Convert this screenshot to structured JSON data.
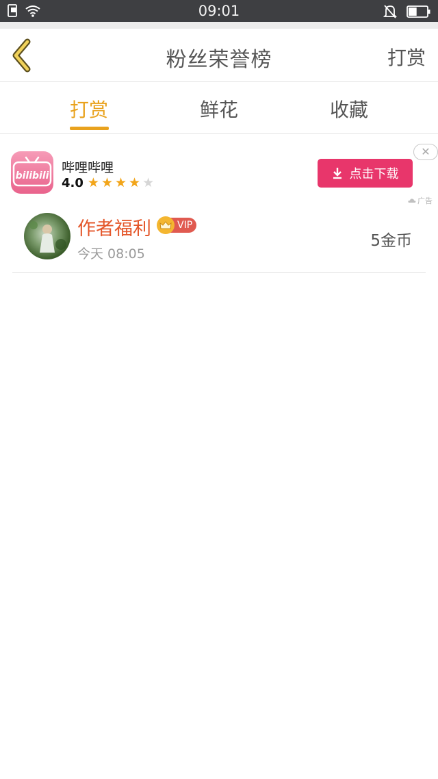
{
  "status_bar": {
    "time": "09:01",
    "battery_level": 0.45
  },
  "header": {
    "title": "粉丝荣誉榜",
    "right_action": "打赏"
  },
  "tabs": [
    {
      "label": "打赏",
      "active": true
    },
    {
      "label": "鲜花",
      "active": false
    },
    {
      "label": "收藏",
      "active": false
    }
  ],
  "ad": {
    "app_name": "哔哩哔哩",
    "rating": "4.0",
    "rating_stars": 4,
    "rating_max": 5,
    "download_label": "点击下载",
    "ad_tag": "广告",
    "icon_text": "bilibili"
  },
  "rewards": [
    {
      "name": "作者福利",
      "badge": "VIP",
      "time": "今天 08:05",
      "amount": "5金币"
    }
  ],
  "colors": {
    "accent": "#e9a21d",
    "download": "#e8366b",
    "username": "#e4582c",
    "status_bar": "#3e3f42"
  }
}
